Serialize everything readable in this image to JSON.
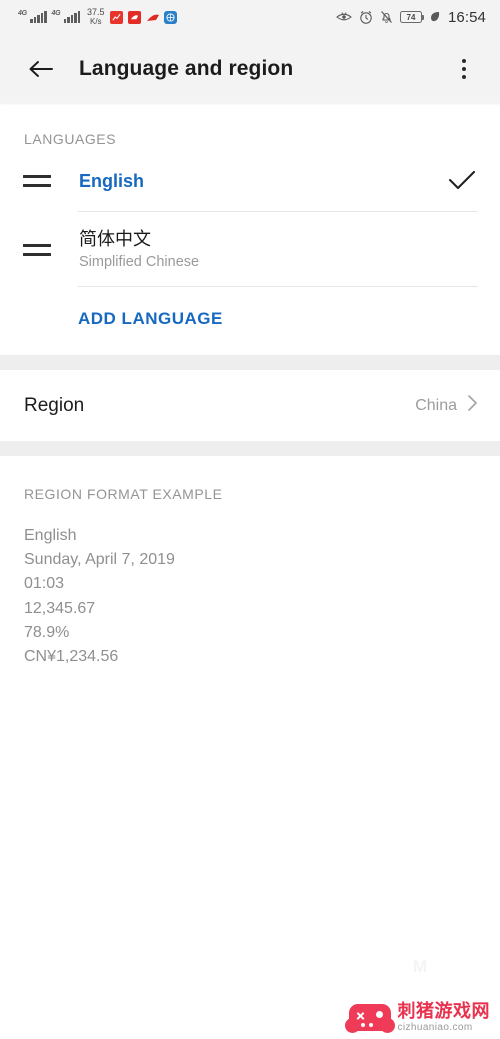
{
  "statusbar": {
    "network_label_1": "4G",
    "network_label_2": "4G",
    "net_speed_value": "37.5",
    "net_speed_unit": "K/s",
    "battery_level": "74",
    "time": "16:54",
    "icons": [
      "signal-4g-icon",
      "signal-4g-icon",
      "network-speed",
      "app-notification-red-chart-icon",
      "app-notification-red-icon",
      "app-notification-arrow-icon",
      "app-notification-blue-icon",
      "eye-comfort-icon",
      "alarm-icon",
      "mute-bell-icon",
      "battery-icon",
      "leaf-power-saving-icon"
    ]
  },
  "appbar": {
    "back_icon": "arrow-left-icon",
    "title": "Language and region",
    "overflow_icon": "more-vertical-icon"
  },
  "languages_section": {
    "header": "LANGUAGES",
    "items": [
      {
        "name": "English",
        "subtitle": "",
        "selected": true,
        "handle_icon": "drag-handle-icon",
        "check_icon": "check-icon"
      },
      {
        "name": "简体中文",
        "subtitle": "Simplified Chinese",
        "selected": false,
        "handle_icon": "drag-handle-icon",
        "check_icon": ""
      }
    ],
    "add_language_label": "ADD LANGUAGE"
  },
  "region_section": {
    "label": "Region",
    "value": "China",
    "chevron_icon": "chevron-right-icon"
  },
  "format_section": {
    "header": "REGION FORMAT EXAMPLE",
    "lines": [
      "English",
      "Sunday, April 7, 2019",
      "01:03",
      "12,345.67",
      "78.9%",
      "CN¥1,234.56"
    ]
  },
  "watermark": {
    "icon": "gamepad-icon",
    "site_name": "刺猪游戏网",
    "site_url": "cizhuaniao.com",
    "faint_mark": "M"
  },
  "colors": {
    "accent_blue": "#1769c0",
    "bar_background": "#f3f3f3",
    "divider": "#e6e6e6",
    "secondary_text": "#9a9a9a",
    "watermark_red": "#e8334f"
  }
}
